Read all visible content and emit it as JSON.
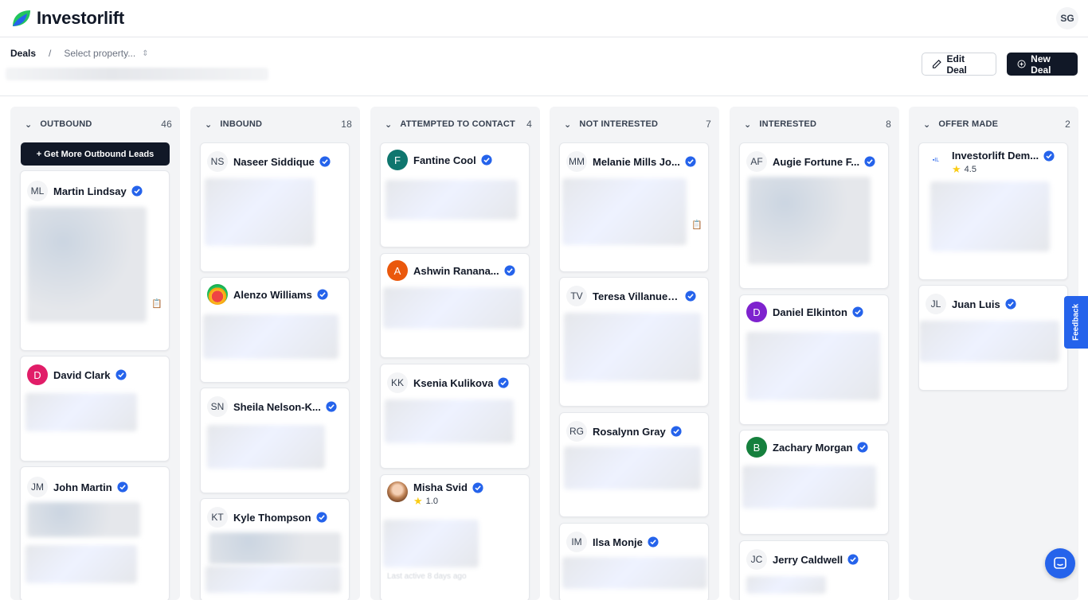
{
  "app": {
    "title": "Investorlift",
    "user_initials": "SG"
  },
  "breadcrumb": {
    "root": "Deals",
    "separator": "/",
    "select_placeholder": "Select property..."
  },
  "actions": {
    "edit_deal": "Edit Deal",
    "new_deal": "New Deal"
  },
  "colors": {
    "accent": "#2563eb",
    "dark": "#111827",
    "column_bg": "#f3f4f6"
  },
  "feedback": "Feedback",
  "columns": [
    {
      "title": "OUTBOUND",
      "count": "46",
      "cta": "+ Get More Outbound Leads",
      "cards": [
        {
          "name": "Martin Lindsay",
          "initials": "ML"
        },
        {
          "name": "David Clark",
          "initials": "D"
        },
        {
          "name": "John Martin",
          "initials": "JM"
        }
      ]
    },
    {
      "title": "INBOUND",
      "count": "18",
      "cards": [
        {
          "name": "Naseer Siddique",
          "initials": "NS"
        },
        {
          "name": "Alenzo Williams",
          "initials": ""
        },
        {
          "name": "Sheila Nelson-K...",
          "initials": "SN"
        },
        {
          "name": "Kyle Thompson",
          "initials": "KT"
        }
      ]
    },
    {
      "title": "ATTEMPTED TO CONTACT",
      "count": "4",
      "cards": [
        {
          "name": "Fantine Cool",
          "initials": "F"
        },
        {
          "name": "Ashwin Ranana...",
          "initials": "A"
        },
        {
          "name": "Ksenia Kulikova",
          "initials": "KK"
        },
        {
          "name": "Misha Svid",
          "initials": "",
          "rating": "1.0",
          "note": "Last active 8 days ago"
        }
      ]
    },
    {
      "title": "NOT INTERESTED",
      "count": "7",
      "cards": [
        {
          "name": "Melanie Mills Jo...",
          "initials": "MM"
        },
        {
          "name": "Teresa Villanuev...",
          "initials": "TV"
        },
        {
          "name": "Rosalynn Gray",
          "initials": "RG"
        },
        {
          "name": "Ilsa Monje",
          "initials": "IM"
        }
      ]
    },
    {
      "title": "INTERESTED",
      "count": "8",
      "cards": [
        {
          "name": "Augie Fortune F...",
          "initials": "AF"
        },
        {
          "name": "Daniel Elkinton",
          "initials": "D"
        },
        {
          "name": "Zachary Morgan",
          "initials": "B"
        },
        {
          "name": "Jerry Caldwell",
          "initials": "JC"
        }
      ]
    },
    {
      "title": "OFFER MADE",
      "count": "2",
      "cards": [
        {
          "name": "Investorlift Dem...",
          "initials": "",
          "rating": "4.5"
        },
        {
          "name": "Juan Luis",
          "initials": "JL"
        }
      ]
    }
  ]
}
